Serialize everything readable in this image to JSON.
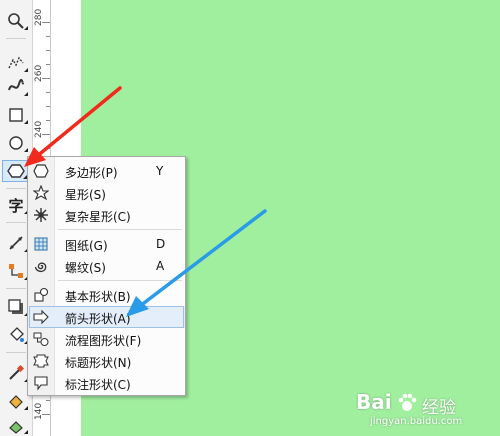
{
  "ruler": {
    "labels": [
      "280",
      "260",
      "240",
      "140"
    ]
  },
  "toolbar": {
    "text_tool_glyph": "字"
  },
  "menu": {
    "items": [
      {
        "label": "多边形(P)",
        "key": "Y"
      },
      {
        "label": "星形(S)",
        "key": ""
      },
      {
        "label": "复杂星形(C)",
        "key": ""
      },
      {
        "label": "图纸(G)",
        "key": "D"
      },
      {
        "label": "螺纹(S)",
        "key": "A"
      },
      {
        "label": "基本形状(B)",
        "key": ""
      },
      {
        "label": "箭头形状(A)",
        "key": ""
      },
      {
        "label": "流程图形状(F)",
        "key": ""
      },
      {
        "label": "标题形状(N)",
        "key": ""
      },
      {
        "label": "标注形状(C)",
        "key": ""
      }
    ],
    "highlighted_index": 6
  },
  "watermark": {
    "brand": "Bai",
    "brand_cn": "经验",
    "url": "jingyan.baidu.com"
  },
  "colors": {
    "canvas": "#a0ef9f",
    "menu_highlight": "#e3eefa",
    "red_arrow": "#f02a1c",
    "blue_arrow": "#2a9be8"
  }
}
